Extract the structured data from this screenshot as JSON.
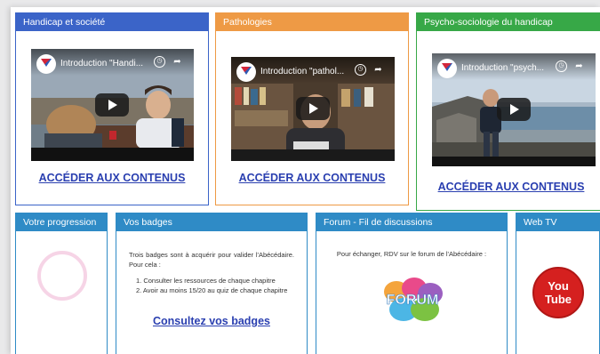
{
  "colors": {
    "blue": "#3b64c8",
    "orange": "#ee9a45",
    "green": "#37a847",
    "light_blue": "#2f8bc6",
    "link": "#2a3fb0"
  },
  "top_cards": [
    {
      "header": "Handicap et société",
      "video_title": "Introduction \"Handi...",
      "link": "ACCÉDER AUX CONTENUS"
    },
    {
      "header": "Pathologies",
      "video_title": "Introduction \"pathol...",
      "link": "ACCÉDER AUX CONTENUS"
    },
    {
      "header": "Psycho-sociologie du handicap",
      "video_title": "Introduction \"psych...",
      "link": "ACCÉDER AUX CONTENUS"
    }
  ],
  "progress": {
    "header": "Votre progression"
  },
  "badges": {
    "header": "Vos badges",
    "intro": "Trois badges sont à acquérir pour valider l'Abécédaire. Pour cela :",
    "items": [
      "1. Consulter les ressources de chaque chapitre",
      "2. Avoir au moins 15/20 au quiz de chaque chapitre"
    ],
    "link": "Consultez vos badges"
  },
  "forum": {
    "header": "Forum - Fil de discussions",
    "text": "Pour échanger, RDV sur le forum de l'Abécédaire :",
    "logo_text": "FORUM"
  },
  "webtv": {
    "header": "Web TV",
    "logo_line1": "You",
    "logo_line2": "Tube"
  },
  "icons": [
    "play-icon",
    "clock-icon",
    "share-icon",
    "channel-logo-icon",
    "progress-ring-icon",
    "forum-logo-icon",
    "youtube-logo-icon"
  ]
}
